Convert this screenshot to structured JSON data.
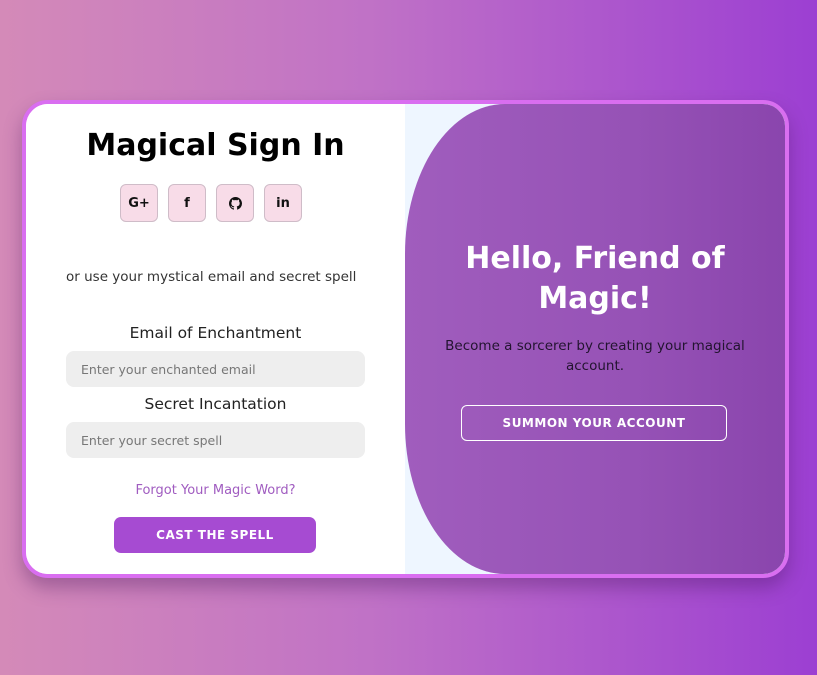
{
  "sign_in": {
    "title": "Magical Sign In",
    "socials": [
      {
        "label": "G+",
        "icon": "google-plus-icon"
      },
      {
        "label": "f",
        "icon": "facebook-icon"
      },
      {
        "label": "",
        "icon": "github-icon"
      },
      {
        "label": "in",
        "icon": "linkedin-icon"
      }
    ],
    "or_text": "or use your mystical email and secret spell",
    "email_label": "Email of Enchantment",
    "email_placeholder": "Enter your enchanted email",
    "email_value": "",
    "spell_label": "Secret Incantation",
    "spell_placeholder": "Enter your secret spell",
    "spell_value": "",
    "forgot_link": "Forgot Your Magic Word?",
    "submit_label": "CAST THE SPELL"
  },
  "overlay": {
    "title": "Hello, Friend of Magic!",
    "text": "Become a sorcerer by creating your magical account.",
    "button_label": "SUMMON YOUR ACCOUNT"
  },
  "colors": {
    "accent": "#a64bd2",
    "card_border": "#d96ef0",
    "social_bg": "#f8dce8",
    "link": "#a05cc0",
    "overlay": "#9652b6"
  }
}
